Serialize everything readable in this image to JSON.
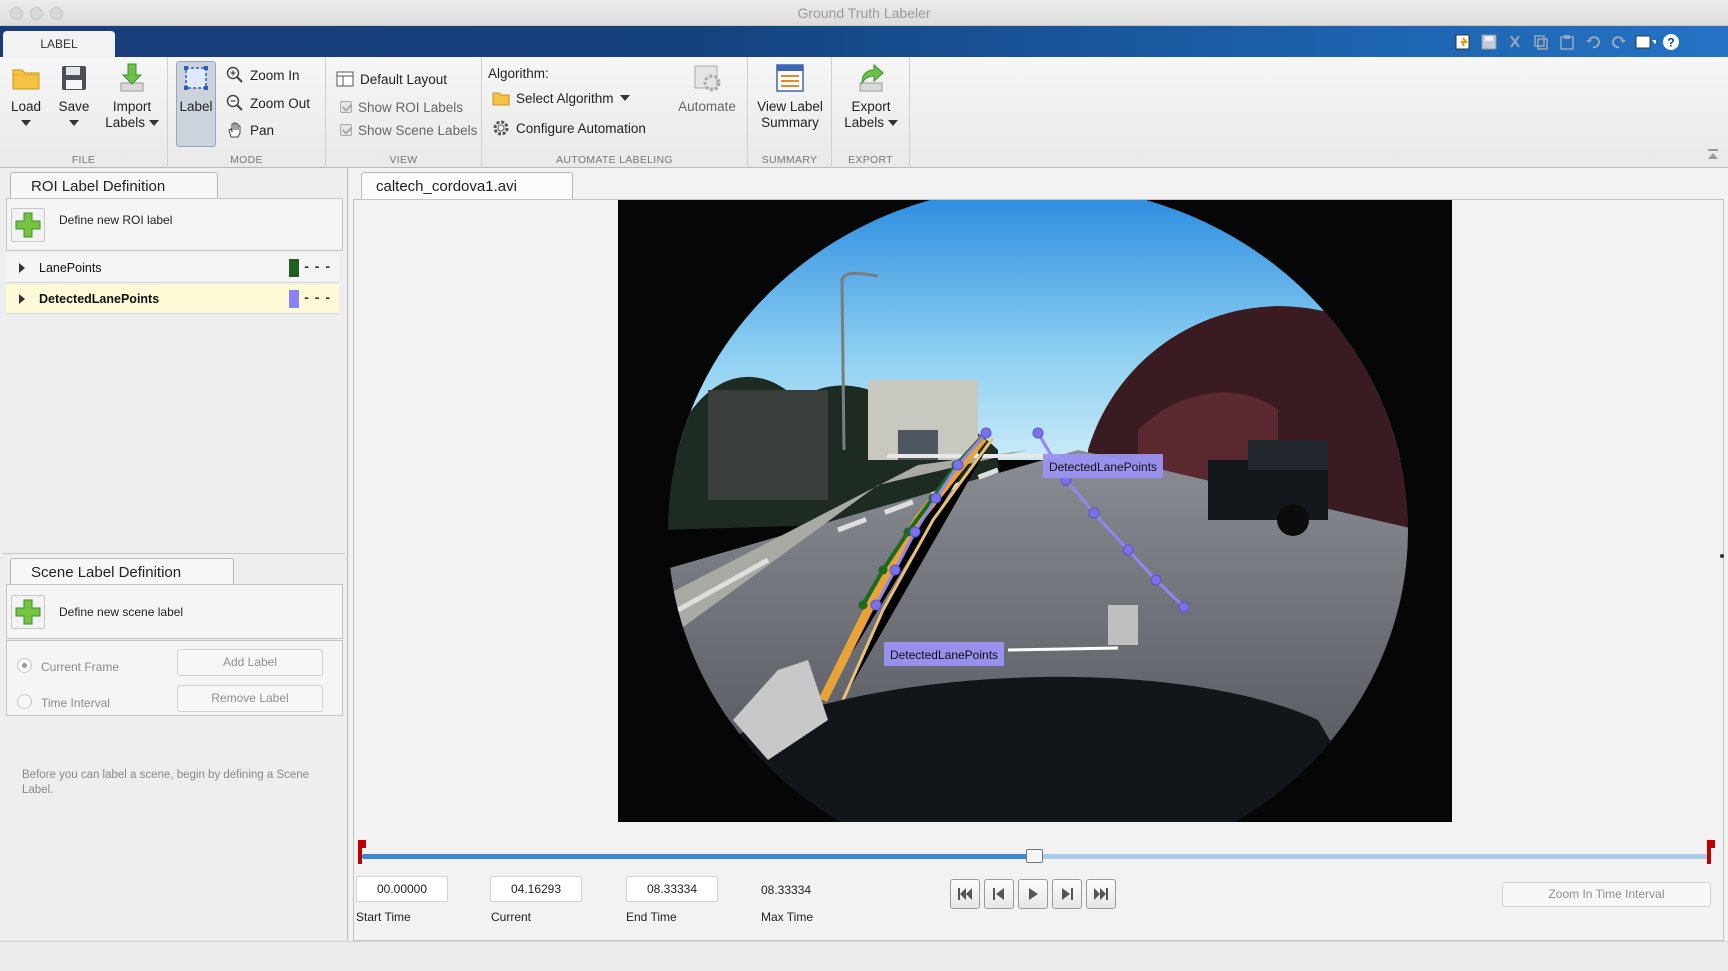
{
  "window": {
    "title": "Ground Truth Labeler",
    "active_tab": "LABEL"
  },
  "ribbon": {
    "file": {
      "group_title": "FILE",
      "load_label": "Load",
      "save_label": "Save",
      "import_label_line1": "Import",
      "import_label_line2": "Labels"
    },
    "mode": {
      "group_title": "MODE",
      "label_label": "Label",
      "zoom_in_label": "Zoom In",
      "zoom_out_label": "Zoom Out",
      "pan_label": "Pan"
    },
    "view": {
      "group_title": "VIEW",
      "default_layout_label": "Default Layout",
      "show_roi_labels_label": "Show ROI Labels",
      "show_scene_labels_label": "Show Scene Labels"
    },
    "automate": {
      "group_title": "AUTOMATE LABELING",
      "algorithm_caption": "Algorithm:",
      "select_algorithm_label": "Select Algorithm",
      "configure_automation_label": "Configure Automation",
      "automate_label": "Automate"
    },
    "summary": {
      "group_title": "SUMMARY",
      "view_label_summary_line1": "View Label",
      "view_label_summary_line2": "Summary"
    },
    "export": {
      "group_title": "EXPORT",
      "export_labels_line1": "Export",
      "export_labels_line2": "Labels"
    }
  },
  "roi_panel": {
    "tab_title": "ROI Label Definition",
    "define_new_label": "Define new ROI label",
    "labels": [
      {
        "name": "LanePoints",
        "color": "#1f5f1f",
        "selected": false
      },
      {
        "name": "DetectedLanePoints",
        "color": "#8a82f0",
        "selected": true
      }
    ]
  },
  "scene_panel": {
    "tab_title": "Scene Label Definition",
    "define_new_label": "Define new scene label",
    "current_frame_label": "Current Frame",
    "time_interval_label": "Time Interval",
    "add_label_button": "Add Label",
    "remove_label_button": "Remove Label",
    "hint_text": "Before you can label a scene, begin by defining a Scene Label."
  },
  "video": {
    "tab_title": "caltech_cordova1.avi",
    "overlay_labels": [
      "DetectedLanePoints",
      "DetectedLanePoints"
    ]
  },
  "timeline": {
    "start_time": "00.00000",
    "current_time": "04.16293",
    "end_time": "08.33334",
    "max_time": "08.33334",
    "start_caption": "Start Time",
    "current_caption": "Current",
    "end_caption": "End Time",
    "max_caption": "Max Time",
    "zoom_button": "Zoom In Time Interval",
    "progress_fraction": 0.4995
  }
}
